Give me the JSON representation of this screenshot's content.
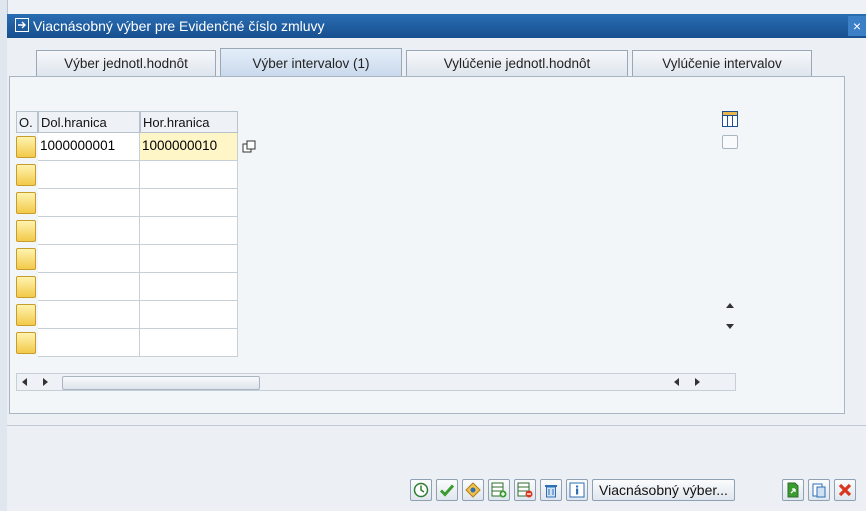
{
  "window": {
    "title": "Viacnásobný výber pre Evidenčné číslo zmluvy",
    "close_label": "×"
  },
  "tabs": [
    {
      "label": "Výber jednotl.hodnôt",
      "active": false
    },
    {
      "label": "Výber intervalov (1)",
      "active": true
    },
    {
      "label": "Vylúčenie jednotl.hodnôt",
      "active": false
    },
    {
      "label": "Vylúčenie intervalov",
      "active": false
    }
  ],
  "table": {
    "columns": [
      "O.",
      "Dol.hranica",
      "Hor.hranica"
    ],
    "rows": [
      {
        "lower": "1000000001",
        "upper": "1000000010"
      },
      {
        "lower": "",
        "upper": ""
      },
      {
        "lower": "",
        "upper": ""
      },
      {
        "lower": "",
        "upper": ""
      },
      {
        "lower": "",
        "upper": ""
      },
      {
        "lower": "",
        "upper": ""
      },
      {
        "lower": "",
        "upper": ""
      },
      {
        "lower": "",
        "upper": ""
      }
    ]
  },
  "toolbar": {
    "multi_select_label": "Viacnásobný výber..."
  },
  "colors": {
    "title_bg": "#1c5fa6",
    "op_button": "#f2c94a",
    "highlight_cell": "#fff6c8",
    "accept_green": "#3a9b2f",
    "cancel_red": "#d9361f"
  }
}
